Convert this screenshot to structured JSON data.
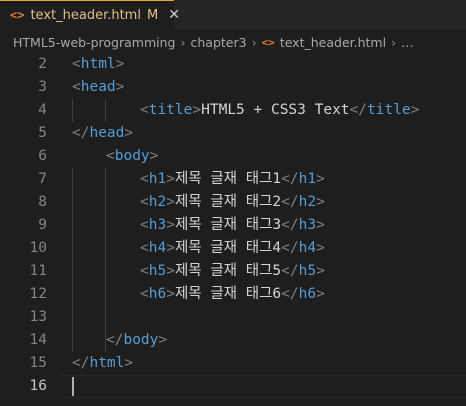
{
  "tab": {
    "icon": "<>",
    "label": "text_header.html",
    "badge": "M",
    "close": "✕"
  },
  "breadcrumb": [
    "HTML5-web-programming",
    "chapter3",
    "text_header.html",
    "…"
  ],
  "breadcrumb_sep": "›",
  "lines": [
    {
      "n": "2",
      "indent": 0,
      "open": "html",
      "close": ""
    },
    {
      "n": "3",
      "indent": 0,
      "open": "head",
      "close": ""
    },
    {
      "n": "4",
      "indent": 2,
      "open": "title",
      "text": "HTML5 + CSS3 Text",
      "close": "title"
    },
    {
      "n": "5",
      "indent": 0,
      "open": "",
      "close": "head"
    },
    {
      "n": "6",
      "indent": 1,
      "open": "body",
      "close": ""
    },
    {
      "n": "7",
      "indent": 2,
      "open": "h1",
      "text": "제목 글재 태그1",
      "close": "h1"
    },
    {
      "n": "8",
      "indent": 2,
      "open": "h2",
      "text": "제목 글재 태그2",
      "close": "h2"
    },
    {
      "n": "9",
      "indent": 2,
      "open": "h3",
      "text": "제목 글재 태그3",
      "close": "h3"
    },
    {
      "n": "10",
      "indent": 2,
      "open": "h4",
      "text": "제목 글재 태그4",
      "close": "h4"
    },
    {
      "n": "11",
      "indent": 2,
      "open": "h5",
      "text": "제목 글재 태그5",
      "close": "h5"
    },
    {
      "n": "12",
      "indent": 2,
      "open": "h6",
      "text": "제목 글재 태그6",
      "close": "h6"
    },
    {
      "n": "13",
      "indent": 0,
      "open": "",
      "close": ""
    },
    {
      "n": "14",
      "indent": 1,
      "open": "",
      "close": "body"
    },
    {
      "n": "15",
      "indent": 0,
      "open": "",
      "close": "html"
    },
    {
      "n": "16",
      "indent": 0,
      "open": "",
      "close": "",
      "active": true
    }
  ],
  "colors": {
    "tag": "#569cd6",
    "punct": "#808080",
    "text": "#d4d4d4",
    "modified": "#e2c08d"
  }
}
